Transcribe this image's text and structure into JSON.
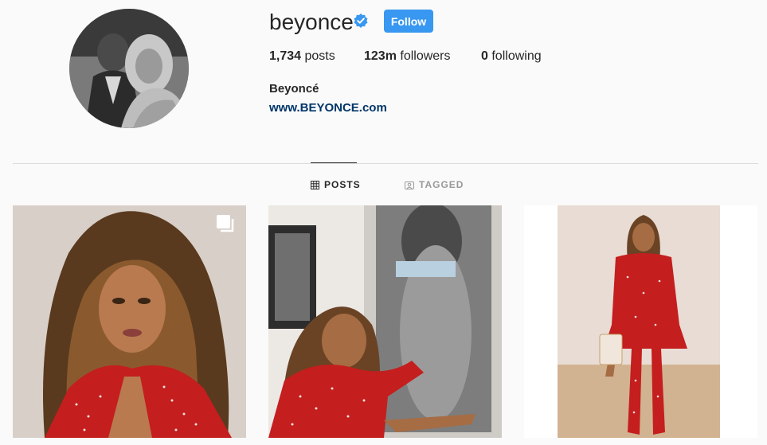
{
  "profile": {
    "username": "beyonce",
    "follow_label": "Follow",
    "stats": {
      "posts_count": "1,734",
      "posts_label": "posts",
      "followers_count": "123m",
      "followers_label": "followers",
      "following_count": "0",
      "following_label": "following"
    },
    "full_name": "Beyoncé",
    "website": "www.BEYONCE.com"
  },
  "tabs": [
    {
      "label": "POSTS",
      "icon": "grid-icon",
      "active": true
    },
    {
      "label": "TAGGED",
      "icon": "tagged-icon",
      "active": false
    }
  ],
  "colors": {
    "follow_button": "#3897f0",
    "verified_badge": "#3897f0",
    "website_link": "#003569"
  }
}
